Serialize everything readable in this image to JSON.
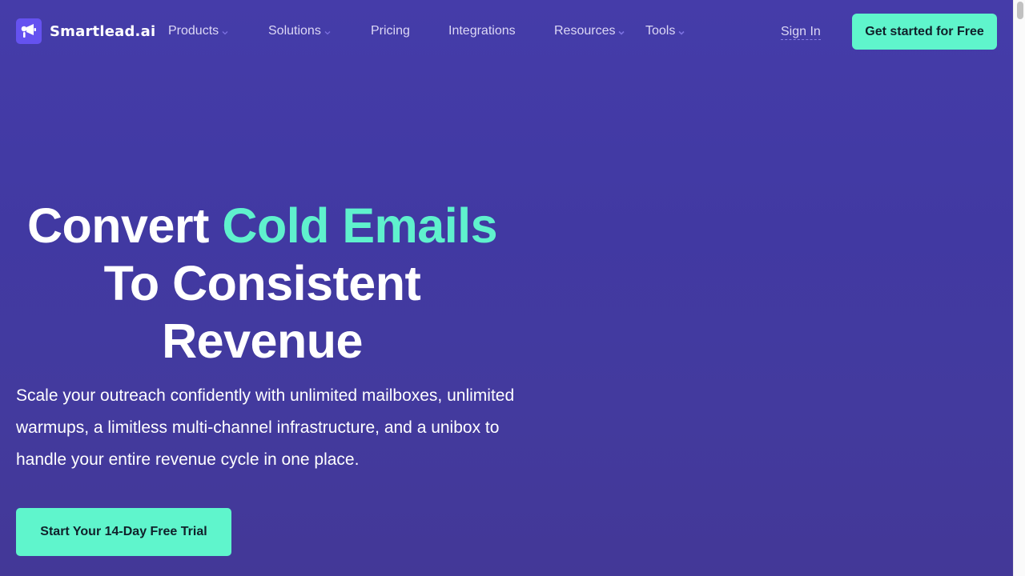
{
  "brand": {
    "name": "Smartlead.ai",
    "logo_icon": "megaphone-icon"
  },
  "nav": {
    "items": [
      {
        "label": "Products",
        "has_dropdown": true
      },
      {
        "label": "Solutions",
        "has_dropdown": true
      },
      {
        "label": "Pricing",
        "has_dropdown": false
      },
      {
        "label": "Integrations",
        "has_dropdown": false
      },
      {
        "label": "Resources",
        "has_dropdown": true
      },
      {
        "label": "Tools",
        "has_dropdown": true
      }
    ],
    "dropdown_icon": "chevron-down-icon",
    "sign_in": "Sign In",
    "cta": "Get started for Free"
  },
  "hero": {
    "title_prefix": "Convert ",
    "title_accent": "Cold Emails",
    "title_line2": "To Consistent",
    "title_line3": "Revenue",
    "description": "Scale your outreach confidently with unlimited mailboxes, unlimited warmups, a limitless multi-channel infrastructure, and a unibox to handle your entire revenue cycle in one place.",
    "cta": "Start Your 14-Day Free Trial"
  },
  "colors": {
    "background": "#433aa3",
    "accent": "#5ff5cc",
    "nav_text": "#dcd8f5",
    "logo_mark": "#6552f0",
    "button_text": "#10202a"
  }
}
